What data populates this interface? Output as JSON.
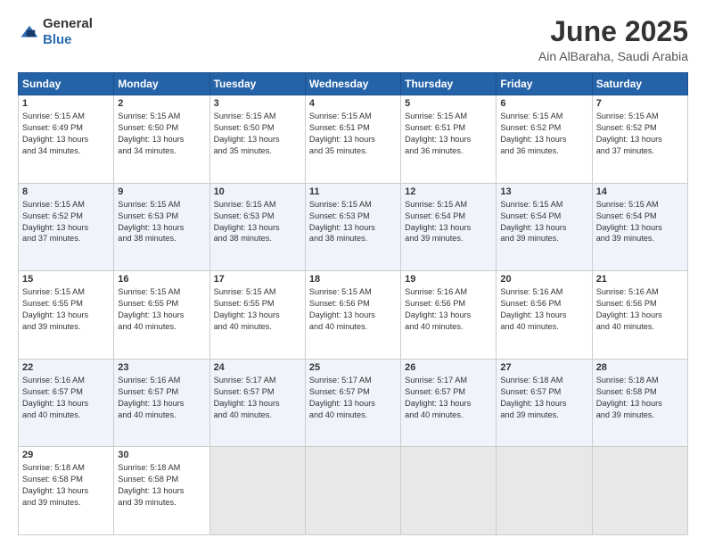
{
  "logo": {
    "general": "General",
    "blue": "Blue"
  },
  "title": "June 2025",
  "subtitle": "Ain AlBaraha, Saudi Arabia",
  "headers": [
    "Sunday",
    "Monday",
    "Tuesday",
    "Wednesday",
    "Thursday",
    "Friday",
    "Saturday"
  ],
  "rows": [
    [
      {
        "day": "1",
        "text": "Sunrise: 5:15 AM\nSunset: 6:49 PM\nDaylight: 13 hours\nand 34 minutes."
      },
      {
        "day": "2",
        "text": "Sunrise: 5:15 AM\nSunset: 6:50 PM\nDaylight: 13 hours\nand 34 minutes."
      },
      {
        "day": "3",
        "text": "Sunrise: 5:15 AM\nSunset: 6:50 PM\nDaylight: 13 hours\nand 35 minutes."
      },
      {
        "day": "4",
        "text": "Sunrise: 5:15 AM\nSunset: 6:51 PM\nDaylight: 13 hours\nand 35 minutes."
      },
      {
        "day": "5",
        "text": "Sunrise: 5:15 AM\nSunset: 6:51 PM\nDaylight: 13 hours\nand 36 minutes."
      },
      {
        "day": "6",
        "text": "Sunrise: 5:15 AM\nSunset: 6:52 PM\nDaylight: 13 hours\nand 36 minutes."
      },
      {
        "day": "7",
        "text": "Sunrise: 5:15 AM\nSunset: 6:52 PM\nDaylight: 13 hours\nand 37 minutes."
      }
    ],
    [
      {
        "day": "8",
        "text": "Sunrise: 5:15 AM\nSunset: 6:52 PM\nDaylight: 13 hours\nand 37 minutes."
      },
      {
        "day": "9",
        "text": "Sunrise: 5:15 AM\nSunset: 6:53 PM\nDaylight: 13 hours\nand 38 minutes."
      },
      {
        "day": "10",
        "text": "Sunrise: 5:15 AM\nSunset: 6:53 PM\nDaylight: 13 hours\nand 38 minutes."
      },
      {
        "day": "11",
        "text": "Sunrise: 5:15 AM\nSunset: 6:53 PM\nDaylight: 13 hours\nand 38 minutes."
      },
      {
        "day": "12",
        "text": "Sunrise: 5:15 AM\nSunset: 6:54 PM\nDaylight: 13 hours\nand 39 minutes."
      },
      {
        "day": "13",
        "text": "Sunrise: 5:15 AM\nSunset: 6:54 PM\nDaylight: 13 hours\nand 39 minutes."
      },
      {
        "day": "14",
        "text": "Sunrise: 5:15 AM\nSunset: 6:54 PM\nDaylight: 13 hours\nand 39 minutes."
      }
    ],
    [
      {
        "day": "15",
        "text": "Sunrise: 5:15 AM\nSunset: 6:55 PM\nDaylight: 13 hours\nand 39 minutes."
      },
      {
        "day": "16",
        "text": "Sunrise: 5:15 AM\nSunset: 6:55 PM\nDaylight: 13 hours\nand 40 minutes."
      },
      {
        "day": "17",
        "text": "Sunrise: 5:15 AM\nSunset: 6:55 PM\nDaylight: 13 hours\nand 40 minutes."
      },
      {
        "day": "18",
        "text": "Sunrise: 5:15 AM\nSunset: 6:56 PM\nDaylight: 13 hours\nand 40 minutes."
      },
      {
        "day": "19",
        "text": "Sunrise: 5:16 AM\nSunset: 6:56 PM\nDaylight: 13 hours\nand 40 minutes."
      },
      {
        "day": "20",
        "text": "Sunrise: 5:16 AM\nSunset: 6:56 PM\nDaylight: 13 hours\nand 40 minutes."
      },
      {
        "day": "21",
        "text": "Sunrise: 5:16 AM\nSunset: 6:56 PM\nDaylight: 13 hours\nand 40 minutes."
      }
    ],
    [
      {
        "day": "22",
        "text": "Sunrise: 5:16 AM\nSunset: 6:57 PM\nDaylight: 13 hours\nand 40 minutes."
      },
      {
        "day": "23",
        "text": "Sunrise: 5:16 AM\nSunset: 6:57 PM\nDaylight: 13 hours\nand 40 minutes."
      },
      {
        "day": "24",
        "text": "Sunrise: 5:17 AM\nSunset: 6:57 PM\nDaylight: 13 hours\nand 40 minutes."
      },
      {
        "day": "25",
        "text": "Sunrise: 5:17 AM\nSunset: 6:57 PM\nDaylight: 13 hours\nand 40 minutes."
      },
      {
        "day": "26",
        "text": "Sunrise: 5:17 AM\nSunset: 6:57 PM\nDaylight: 13 hours\nand 40 minutes."
      },
      {
        "day": "27",
        "text": "Sunrise: 5:18 AM\nSunset: 6:57 PM\nDaylight: 13 hours\nand 39 minutes."
      },
      {
        "day": "28",
        "text": "Sunrise: 5:18 AM\nSunset: 6:58 PM\nDaylight: 13 hours\nand 39 minutes."
      }
    ],
    [
      {
        "day": "29",
        "text": "Sunrise: 5:18 AM\nSunset: 6:58 PM\nDaylight: 13 hours\nand 39 minutes."
      },
      {
        "day": "30",
        "text": "Sunrise: 5:18 AM\nSunset: 6:58 PM\nDaylight: 13 hours\nand 39 minutes."
      },
      {
        "day": "",
        "text": ""
      },
      {
        "day": "",
        "text": ""
      },
      {
        "day": "",
        "text": ""
      },
      {
        "day": "",
        "text": ""
      },
      {
        "day": "",
        "text": ""
      }
    ]
  ]
}
